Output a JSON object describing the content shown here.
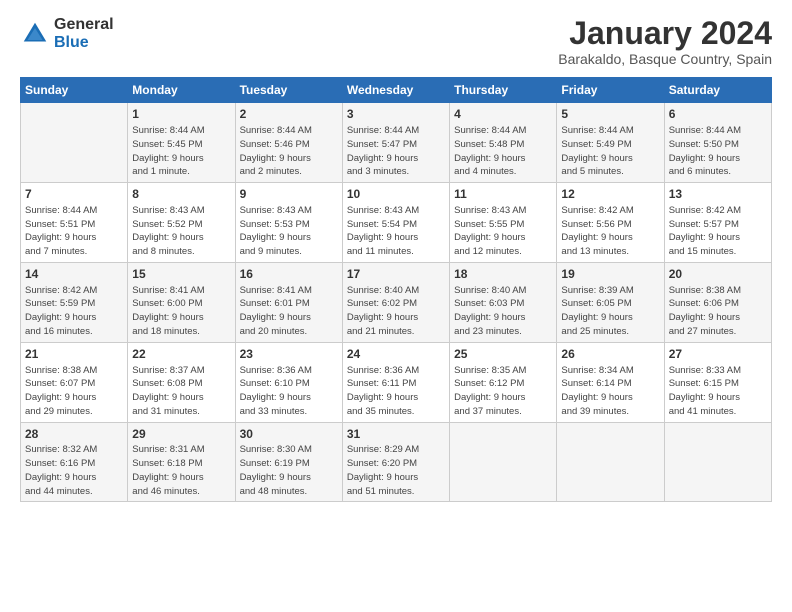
{
  "header": {
    "logo_general": "General",
    "logo_blue": "Blue",
    "month_title": "January 2024",
    "subtitle": "Barakaldo, Basque Country, Spain"
  },
  "days_of_week": [
    "Sunday",
    "Monday",
    "Tuesday",
    "Wednesday",
    "Thursday",
    "Friday",
    "Saturday"
  ],
  "weeks": [
    [
      {
        "day": "",
        "info": ""
      },
      {
        "day": "1",
        "info": "Sunrise: 8:44 AM\nSunset: 5:45 PM\nDaylight: 9 hours\nand 1 minute."
      },
      {
        "day": "2",
        "info": "Sunrise: 8:44 AM\nSunset: 5:46 PM\nDaylight: 9 hours\nand 2 minutes."
      },
      {
        "day": "3",
        "info": "Sunrise: 8:44 AM\nSunset: 5:47 PM\nDaylight: 9 hours\nand 3 minutes."
      },
      {
        "day": "4",
        "info": "Sunrise: 8:44 AM\nSunset: 5:48 PM\nDaylight: 9 hours\nand 4 minutes."
      },
      {
        "day": "5",
        "info": "Sunrise: 8:44 AM\nSunset: 5:49 PM\nDaylight: 9 hours\nand 5 minutes."
      },
      {
        "day": "6",
        "info": "Sunrise: 8:44 AM\nSunset: 5:50 PM\nDaylight: 9 hours\nand 6 minutes."
      }
    ],
    [
      {
        "day": "7",
        "info": "Sunrise: 8:44 AM\nSunset: 5:51 PM\nDaylight: 9 hours\nand 7 minutes."
      },
      {
        "day": "8",
        "info": "Sunrise: 8:43 AM\nSunset: 5:52 PM\nDaylight: 9 hours\nand 8 minutes."
      },
      {
        "day": "9",
        "info": "Sunrise: 8:43 AM\nSunset: 5:53 PM\nDaylight: 9 hours\nand 9 minutes."
      },
      {
        "day": "10",
        "info": "Sunrise: 8:43 AM\nSunset: 5:54 PM\nDaylight: 9 hours\nand 11 minutes."
      },
      {
        "day": "11",
        "info": "Sunrise: 8:43 AM\nSunset: 5:55 PM\nDaylight: 9 hours\nand 12 minutes."
      },
      {
        "day": "12",
        "info": "Sunrise: 8:42 AM\nSunset: 5:56 PM\nDaylight: 9 hours\nand 13 minutes."
      },
      {
        "day": "13",
        "info": "Sunrise: 8:42 AM\nSunset: 5:57 PM\nDaylight: 9 hours\nand 15 minutes."
      }
    ],
    [
      {
        "day": "14",
        "info": "Sunrise: 8:42 AM\nSunset: 5:59 PM\nDaylight: 9 hours\nand 16 minutes."
      },
      {
        "day": "15",
        "info": "Sunrise: 8:41 AM\nSunset: 6:00 PM\nDaylight: 9 hours\nand 18 minutes."
      },
      {
        "day": "16",
        "info": "Sunrise: 8:41 AM\nSunset: 6:01 PM\nDaylight: 9 hours\nand 20 minutes."
      },
      {
        "day": "17",
        "info": "Sunrise: 8:40 AM\nSunset: 6:02 PM\nDaylight: 9 hours\nand 21 minutes."
      },
      {
        "day": "18",
        "info": "Sunrise: 8:40 AM\nSunset: 6:03 PM\nDaylight: 9 hours\nand 23 minutes."
      },
      {
        "day": "19",
        "info": "Sunrise: 8:39 AM\nSunset: 6:05 PM\nDaylight: 9 hours\nand 25 minutes."
      },
      {
        "day": "20",
        "info": "Sunrise: 8:38 AM\nSunset: 6:06 PM\nDaylight: 9 hours\nand 27 minutes."
      }
    ],
    [
      {
        "day": "21",
        "info": "Sunrise: 8:38 AM\nSunset: 6:07 PM\nDaylight: 9 hours\nand 29 minutes."
      },
      {
        "day": "22",
        "info": "Sunrise: 8:37 AM\nSunset: 6:08 PM\nDaylight: 9 hours\nand 31 minutes."
      },
      {
        "day": "23",
        "info": "Sunrise: 8:36 AM\nSunset: 6:10 PM\nDaylight: 9 hours\nand 33 minutes."
      },
      {
        "day": "24",
        "info": "Sunrise: 8:36 AM\nSunset: 6:11 PM\nDaylight: 9 hours\nand 35 minutes."
      },
      {
        "day": "25",
        "info": "Sunrise: 8:35 AM\nSunset: 6:12 PM\nDaylight: 9 hours\nand 37 minutes."
      },
      {
        "day": "26",
        "info": "Sunrise: 8:34 AM\nSunset: 6:14 PM\nDaylight: 9 hours\nand 39 minutes."
      },
      {
        "day": "27",
        "info": "Sunrise: 8:33 AM\nSunset: 6:15 PM\nDaylight: 9 hours\nand 41 minutes."
      }
    ],
    [
      {
        "day": "28",
        "info": "Sunrise: 8:32 AM\nSunset: 6:16 PM\nDaylight: 9 hours\nand 44 minutes."
      },
      {
        "day": "29",
        "info": "Sunrise: 8:31 AM\nSunset: 6:18 PM\nDaylight: 9 hours\nand 46 minutes."
      },
      {
        "day": "30",
        "info": "Sunrise: 8:30 AM\nSunset: 6:19 PM\nDaylight: 9 hours\nand 48 minutes."
      },
      {
        "day": "31",
        "info": "Sunrise: 8:29 AM\nSunset: 6:20 PM\nDaylight: 9 hours\nand 51 minutes."
      },
      {
        "day": "",
        "info": ""
      },
      {
        "day": "",
        "info": ""
      },
      {
        "day": "",
        "info": ""
      }
    ]
  ]
}
